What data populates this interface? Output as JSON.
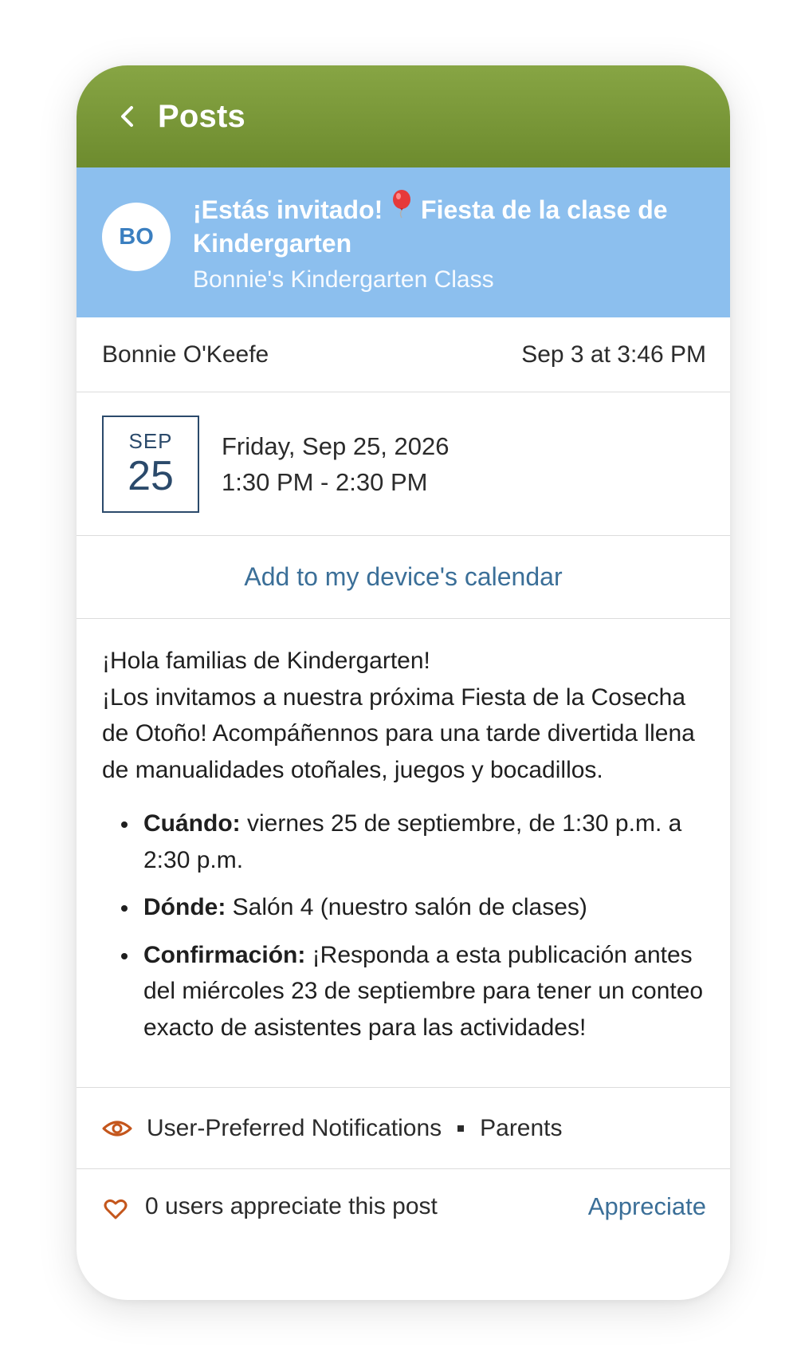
{
  "header": {
    "title": "Posts"
  },
  "post": {
    "avatar_initials": "BO",
    "title_part1": "¡Estás invitado!",
    "title_part2": "Fiesta de la clase de Kindergarten",
    "class_name": "Bonnie's Kindergarten Class",
    "author": "Bonnie O'Keefe",
    "posted_at": "Sep 3 at 3:46 PM"
  },
  "event": {
    "month": "SEP",
    "day": "25",
    "date_line": "Friday, Sep 25, 2026",
    "time_line": "1:30 PM - 2:30 PM",
    "add_calendar_label": "Add to my device's calendar"
  },
  "body": {
    "greeting": "¡Hola familias de Kindergarten!",
    "paragraph": "¡Los invitamos a nuestra próxima Fiesta de la Cosecha de Otoño! Acompáñennos para una tarde divertida llena de manualidades otoñales, juegos y bocadillos.",
    "bullets": [
      {
        "label": "Cuándo:",
        "text": " viernes 25 de septiembre, de 1:30 p.m. a 2:30 p.m."
      },
      {
        "label": "Dónde:",
        "text": " Salón 4 (nuestro salón de clases)"
      },
      {
        "label": "Confirmación:",
        "text": " ¡Responda a esta publicación antes del miércoles 23 de septiembre para tener un conteo exacto de asistentes para las actividades!"
      }
    ]
  },
  "footer": {
    "notification_type": "User-Preferred Notifications",
    "audience": "Parents",
    "appreciation_count_text": "0 users appreciate this post",
    "appreciate_label": "Appreciate"
  },
  "colors": {
    "header_green": "#7a9a3a",
    "banner_blue": "#8cbfee",
    "link_blue": "#3b6f98",
    "icon_orange": "#c4561c"
  },
  "icons": {
    "back": "chevron-left-icon",
    "balloon": "balloon-icon",
    "eye": "eye-icon",
    "heart": "heart-icon"
  }
}
